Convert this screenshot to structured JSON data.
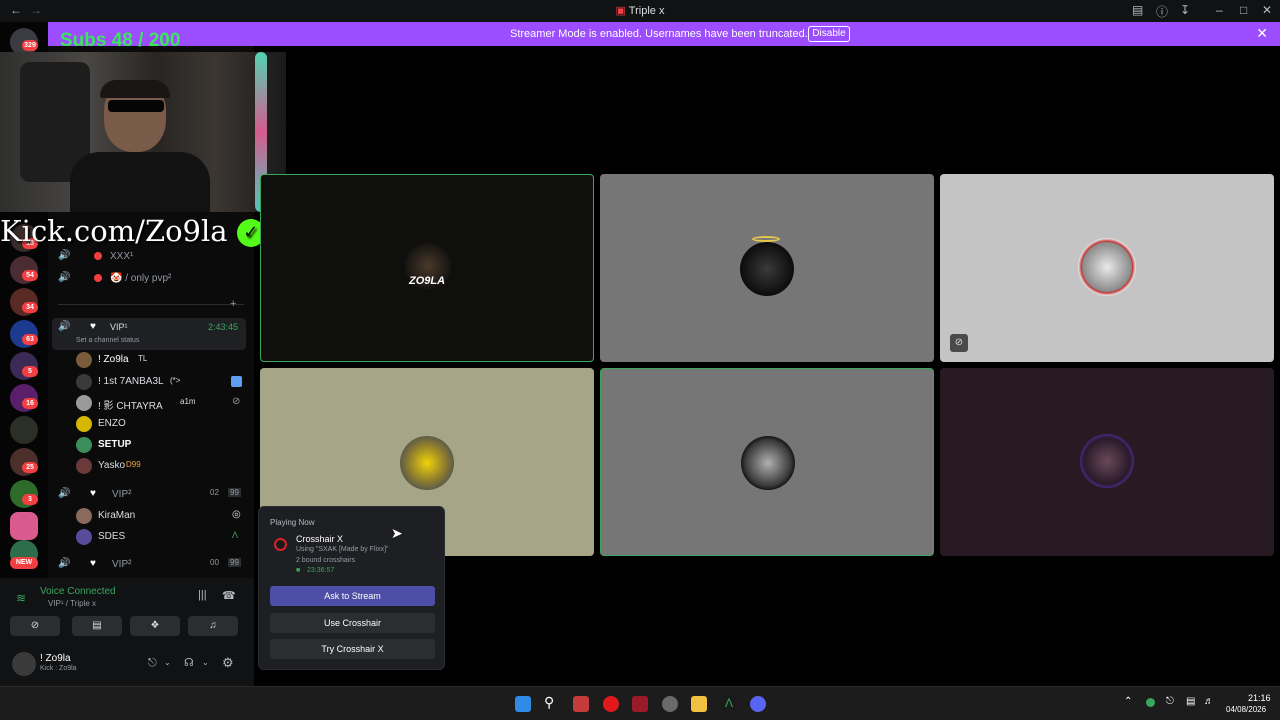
{
  "window": {
    "title": "Triple x"
  },
  "banner": {
    "message": "Streamer Mode is enabled. Usernames have been truncated.",
    "button": "Disable",
    "color": "#9b4dff"
  },
  "rail": {
    "badges": [
      "329",
      "18",
      "54",
      "34",
      "63",
      "5",
      "16",
      "25",
      "3"
    ],
    "new_label": "NEW"
  },
  "overlay": {
    "subs": "Subs 48 / 200",
    "kick": "Kick.com/Zo9la"
  },
  "sidebar": {
    "channels": [
      {
        "label": "XXX¹"
      },
      {
        "label": "🤡 / only pvp²"
      }
    ],
    "active_channel": {
      "label": "VIP¹",
      "timer": "2:43:45",
      "status": "Set a channel status"
    },
    "members": [
      {
        "name": "! Zo9la",
        "tag": "TL"
      },
      {
        "name": "! 1st 7ANBA3L",
        "tag": "(*>"
      },
      {
        "name": "! 影 CHTAYRA",
        "tag": "a1m"
      },
      {
        "name": "ENZO",
        "tag": ""
      },
      {
        "name": "SETUP",
        "tag": ""
      },
      {
        "name": "Yasko",
        "tag": "D99"
      }
    ],
    "vip2": {
      "label": "VIP²",
      "count_a": "02",
      "count_b": "99"
    },
    "vip2_members": [
      {
        "name": "KiraMan"
      },
      {
        "name": "SDES"
      }
    ],
    "vip3": {
      "label": "VIP²",
      "count_a": "00",
      "count_b": "99"
    }
  },
  "voice": {
    "status": "Voice Connected",
    "channel": "VIP¹ / Triple x",
    "user": {
      "name": "! Zo9la",
      "sub": "Kick : Zo9la"
    }
  },
  "tiles": [
    {
      "caption": "ZO9LA"
    }
  ],
  "popup": {
    "header": "Playing Now",
    "game": "Crosshair X",
    "line1": "Using \"SXAK [Made by Flixx]\"",
    "line2": "2 bound crosshairs",
    "time": "23:36:57",
    "btn_stream": "Ask to Stream",
    "btn_use": "Use Crosshair",
    "btn_try": "Try Crosshair X"
  },
  "taskbar": {
    "time": "21:16",
    "date": "04/08/2026"
  },
  "colors": {
    "speaking": "#3ba55d",
    "accent": "#5865f2"
  }
}
